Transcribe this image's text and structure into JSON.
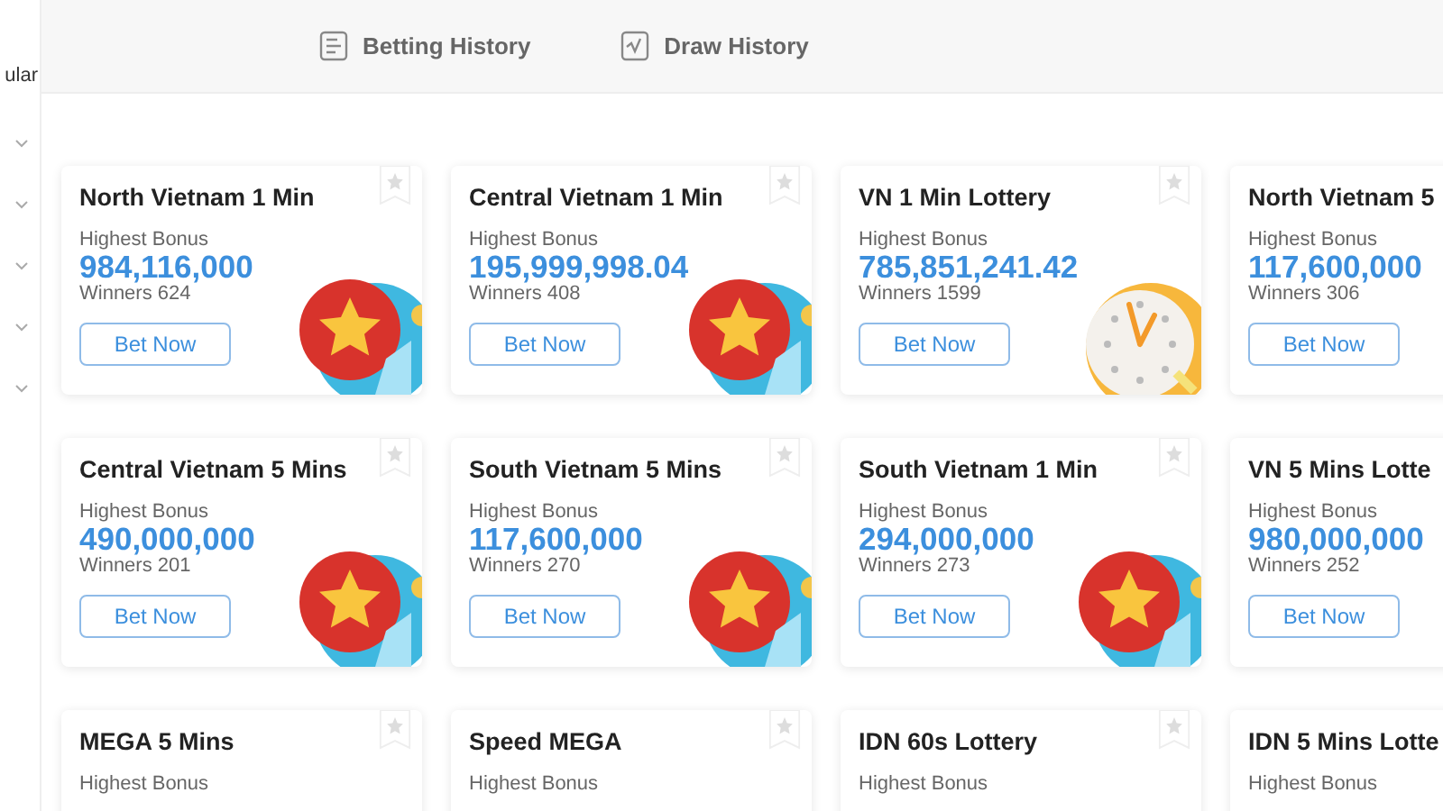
{
  "sidebar": {
    "label": "ular"
  },
  "tabs": [
    {
      "label": "Betting History",
      "kind": "list",
      "selected": false
    },
    {
      "label": "Draw History",
      "kind": "chart",
      "selected": false
    }
  ],
  "games": [
    {
      "title": "North Vietnam 1 Min",
      "bonus_label": "Highest Bonus",
      "bonus": "984,116,000",
      "winners": "Winners 624",
      "button": "Bet Now",
      "kind": "star"
    },
    {
      "title": "Central Vietnam 1 Min",
      "bonus_label": "Highest Bonus",
      "bonus": "195,999,998.04",
      "winners": "Winners 408",
      "button": "Bet Now",
      "kind": "star"
    },
    {
      "title": "VN 1 Min Lottery",
      "bonus_label": "Highest Bonus",
      "bonus": "785,851,241.42",
      "winners": "Winners 1599",
      "button": "Bet Now",
      "kind": "clock"
    },
    {
      "title": "North Vietnam 5",
      "bonus_label": "Highest Bonus",
      "bonus": "117,600,000",
      "winners": "Winners 306",
      "button": "Bet Now",
      "kind": "plain"
    },
    {
      "title": "Central Vietnam 5 Mins",
      "bonus_label": "Highest Bonus",
      "bonus": "490,000,000",
      "winners": "Winners 201",
      "button": "Bet Now",
      "kind": "star"
    },
    {
      "title": "South Vietnam 5 Mins",
      "bonus_label": "Highest Bonus",
      "bonus": "117,600,000",
      "winners": "Winners 270",
      "button": "Bet Now",
      "kind": "star"
    },
    {
      "title": "South Vietnam 1 Min",
      "bonus_label": "Highest Bonus",
      "bonus": "294,000,000",
      "winners": "Winners 273",
      "button": "Bet Now",
      "kind": "star"
    },
    {
      "title": "VN 5 Mins Lotte",
      "bonus_label": "Highest Bonus",
      "bonus": "980,000,000",
      "winners": "Winners 252",
      "button": "Bet Now",
      "kind": "plain"
    },
    {
      "title": "MEGA 5 Mins",
      "bonus_label": "Highest Bonus",
      "kind": "plain"
    },
    {
      "title": "Speed MEGA",
      "bonus_label": "Highest Bonus",
      "kind": "plain"
    },
    {
      "title": "IDN 60s Lottery",
      "bonus_label": "Highest Bonus",
      "kind": "plain"
    },
    {
      "title": "IDN 5 Mins Lotte",
      "bonus_label": "Highest Bonus",
      "kind": "plain"
    }
  ]
}
